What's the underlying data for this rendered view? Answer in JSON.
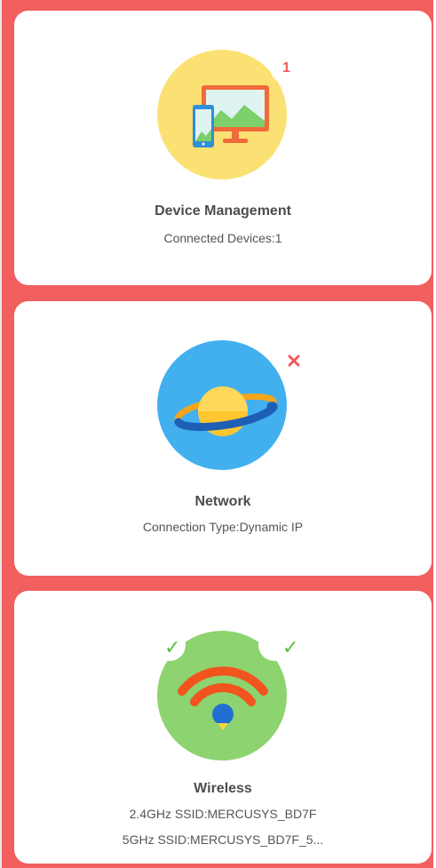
{
  "colors": {
    "background": "#f15f5f",
    "card": "#ffffff",
    "device_circle": "#fbe173",
    "network_circle": "#42b0ef",
    "wireless_circle": "#8dd36f",
    "badge_red": "#f25959",
    "check_green": "#5cbd3b"
  },
  "cards": [
    {
      "title": "Device Management",
      "lines": [
        "Connected Devices:1"
      ],
      "icon": "devices-icon",
      "badge": "1"
    },
    {
      "title": "Network",
      "lines": [
        "Connection Type:Dynamic IP"
      ],
      "icon": "planet-icon",
      "badge_icon": "error-x-icon"
    },
    {
      "title": "Wireless",
      "lines": [
        "2.4GHz SSID:MERCUSYS_BD7F",
        "5GHz SSID:MERCUSYS_BD7F_5..."
      ],
      "icon": "wifi-icon",
      "badge_icons": [
        "check-icon",
        "check-icon"
      ]
    }
  ]
}
